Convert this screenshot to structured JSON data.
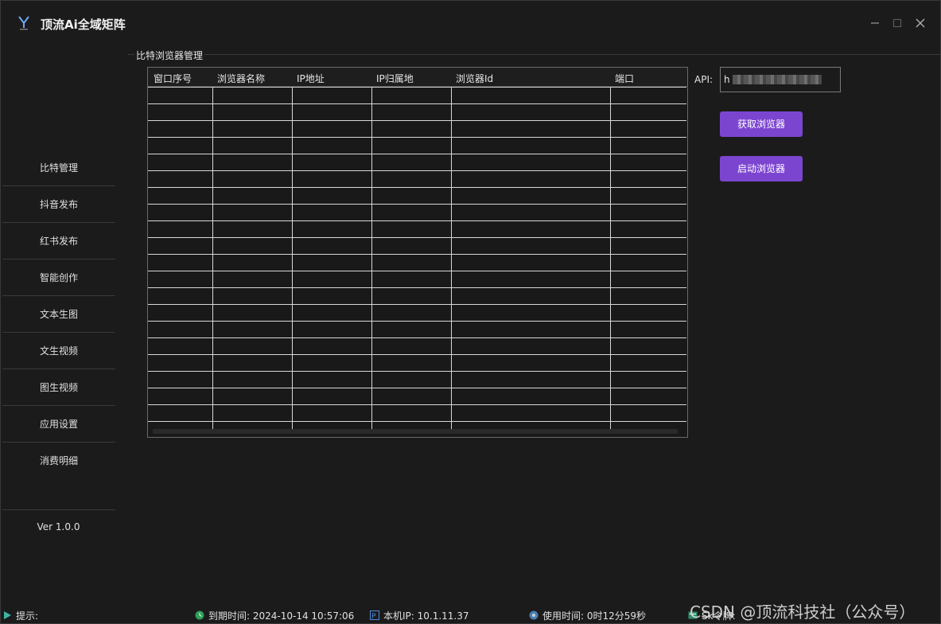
{
  "window": {
    "title": "顶流Ai全域矩阵"
  },
  "sidebar": {
    "items": [
      {
        "label": "比特管理"
      },
      {
        "label": "抖音发布"
      },
      {
        "label": "红书发布"
      },
      {
        "label": "智能创作"
      },
      {
        "label": "文本生图"
      },
      {
        "label": "文生视频"
      },
      {
        "label": "图生视频"
      },
      {
        "label": "应用设置"
      },
      {
        "label": "消费明细"
      }
    ],
    "version": "Ver 1.0.0"
  },
  "group": {
    "title": "比特浏览器管理"
  },
  "table": {
    "columns": [
      "窗口序号",
      "浏览器名称",
      "IP地址",
      "IP归属地",
      "浏览器Id",
      "端口"
    ],
    "rows": []
  },
  "api": {
    "label": "API:",
    "value": "h"
  },
  "buttons": {
    "get_browser": "获取浏览器",
    "start_browser": "启动浏览器"
  },
  "status": {
    "tip": "提示:",
    "expire": "到期时间: 2024-10-14 10:57:06",
    "ip": "本机IP: 10.1.11.37",
    "usage": "使用时间: 0时12分59秒",
    "sk": "Sk令牌:"
  },
  "watermark": "CSDN @顶流科技社（公众号）",
  "colors": {
    "background": "#1b1b1b",
    "accent": "#7c45d0",
    "grid": "#d8d8d8"
  }
}
